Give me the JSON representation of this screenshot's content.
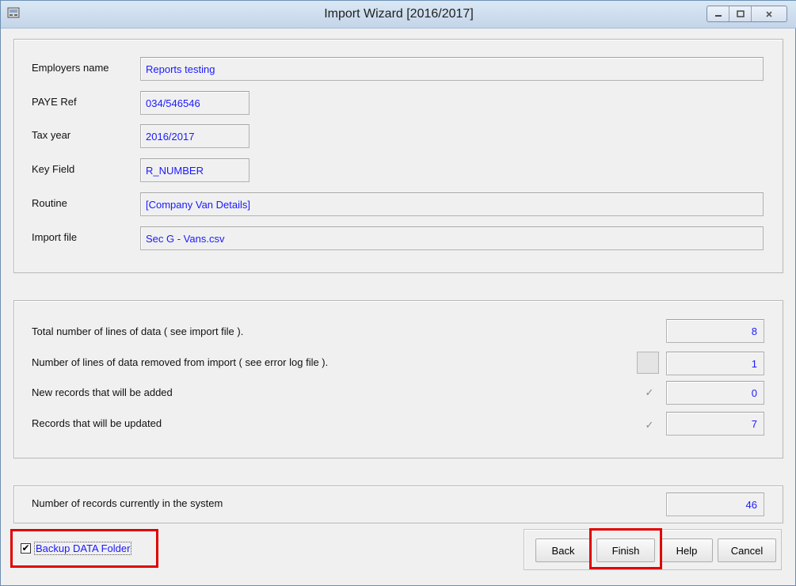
{
  "window": {
    "title": "Import Wizard [2016/2017]",
    "controls": [
      "minimize-icon",
      "maximize-icon",
      "close-icon"
    ]
  },
  "details": {
    "employers_name": {
      "label": "Employers name",
      "value": "Reports testing"
    },
    "paye_ref": {
      "label": "PAYE Ref",
      "value": "034/546546"
    },
    "tax_year": {
      "label": "Tax year",
      "value": "2016/2017"
    },
    "key_field": {
      "label": "Key Field",
      "value": "R_NUMBER"
    },
    "routine": {
      "label": "Routine",
      "value": "[Company Van Details]"
    },
    "import_file": {
      "label": "Import file",
      "value": "Sec G - Vans.csv"
    }
  },
  "summary": {
    "total_lines": {
      "label": "Total number of lines of data ( see import file ).",
      "value": "8"
    },
    "removed_lines": {
      "label": "Number of lines of data removed from import ( see error log file ).",
      "value": "1"
    },
    "new_records": {
      "label": "New records that will be added",
      "value": "0",
      "checked": true
    },
    "updated_records": {
      "label": "Records that will be updated",
      "value": "7",
      "checked": true
    }
  },
  "system": {
    "current_records": {
      "label": "Number of records currently in the system",
      "value": "46"
    }
  },
  "footer": {
    "backup_label": "Backup DATA Folder",
    "backup_checked": true,
    "back_label": "Back",
    "finish_label": "Finish",
    "help_label": "Help",
    "cancel_label": "Cancel"
  },
  "colors": {
    "value_text": "#1a1aff",
    "highlight": "#e00000"
  }
}
